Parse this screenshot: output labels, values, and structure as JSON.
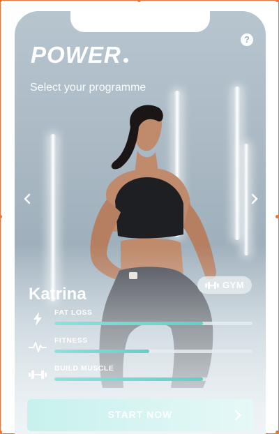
{
  "app": {
    "logo_text": "POWER",
    "subtitle": "Select your programme"
  },
  "header": {
    "help_label": "?"
  },
  "trainer": {
    "name": "Katrina",
    "badge_label": "GYM",
    "badge_icon": "dumbbell-icon"
  },
  "goals": [
    {
      "label": "FAT LOSS",
      "icon": "lightning-icon",
      "level": 0.75
    },
    {
      "label": "FITNESS",
      "icon": "heartbeat-icon",
      "level": 0.48
    },
    {
      "label": "BUILD MUSCLE",
      "icon": "dumbbell-icon",
      "level": 0.75
    }
  ],
  "cta": {
    "label": "START NOW",
    "icon": "chevron-right-icon"
  },
  "colors": {
    "accent": "#63cfc7",
    "frame": "#e8743b",
    "text": "#ffffff"
  }
}
